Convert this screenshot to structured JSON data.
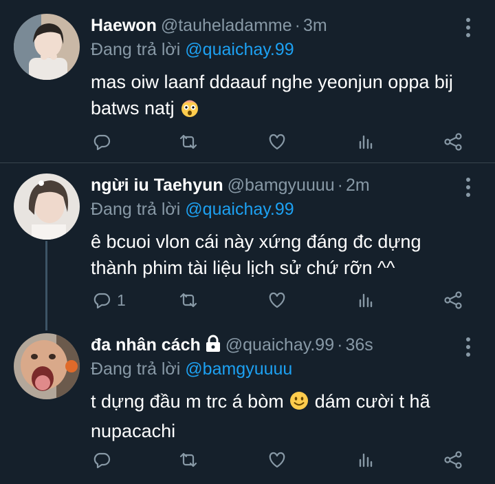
{
  "colors": {
    "background": "#15202b",
    "divider": "#38444d",
    "muted": "#8899a6",
    "mention": "#1da1f2",
    "text": "#ffffff"
  },
  "tweets": [
    {
      "name": "Haewon",
      "handle": "@tauheladamme",
      "time": "3m",
      "reply_prefix": "Đang trả lời",
      "reply_to": "@quaichay.99",
      "text": "mas oiw laanf ddaauf nghe yeonjun oppa bij batws natj",
      "emoji": "astonished-face-emoji",
      "reply_count": ""
    },
    {
      "name": "ngừi iu Taehyun",
      "handle": "@bamgyuuuu",
      "time": "2m",
      "reply_prefix": "Đang trả lời",
      "reply_to": "@quaichay.99",
      "text_line1": "ê bcuoi vlon cái này xứng đáng đc dựng",
      "text_line2": "thành phim tài liệu lịch sử chứ rỡn ^^",
      "reply_count": "1"
    },
    {
      "name": "đa nhân cách",
      "handle": "@quaichay.99",
      "time": "36s",
      "reply_prefix": "Đang trả lời",
      "reply_to": "@bamgyuuuu",
      "text_part1": "t dựng đầu m trc á bòm",
      "emoji": "slightly-smiling-face-emoji",
      "text_part2": "dám cười t hã",
      "text_line2": "nupacachi",
      "reply_count": ""
    }
  ],
  "separator": "·"
}
